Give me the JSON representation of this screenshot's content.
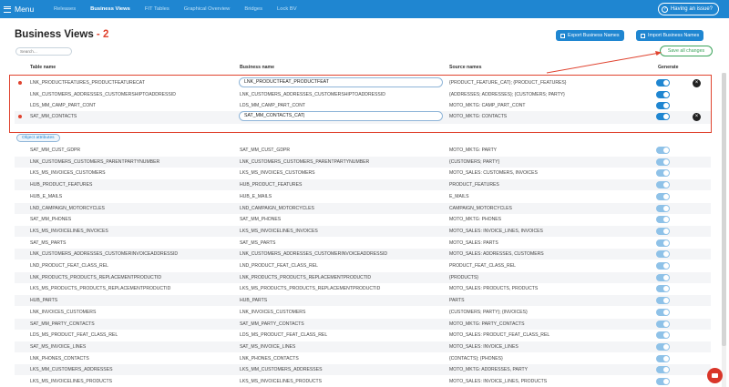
{
  "topbar": {
    "menu_label": "Menu",
    "nav": [
      "Releases",
      "Business Views",
      "FIT Tables",
      "Graphical Overview",
      "Bridges",
      "Lock BV"
    ],
    "active_nav": "Business Views",
    "issue_label": "Having an issue?"
  },
  "page": {
    "title": "Business Views",
    "title_sep": " - ",
    "count": "2",
    "export_label": "Export Business Names",
    "import_label": "Import Business Names",
    "save_label": "Save all changes",
    "search_placeholder": "Search...",
    "object_attributes_label": "Object attributes"
  },
  "table": {
    "headers": {
      "table_name": "Table name",
      "business_name": "Business name",
      "source_names": "Source names",
      "generate": "Generate"
    },
    "edited_rows": [
      {
        "table": "LNK_PRODUCTFEATURES_PRODUCTFEATURECAT",
        "business": "LNK_PRODUCTFEAT_PRODUCTFEAT",
        "source": "{PRODUCT_FEATURE_CAT}; {PRODUCT_FEATURES}",
        "edited": true,
        "editing": true
      },
      {
        "table": "LNK_CUSTOMERS_ADDRESSES_CUSTOMERSHIPTOADDRESSID",
        "business": "LNK_CUSTOMERS_ADDRESSES_CUSTOMERSHIPTOADDRESSID",
        "source": "{ADDRESSES; ADDRESSES}; {CUSTOMERS; PARTY}",
        "edited": false,
        "editing": false
      },
      {
        "table": "LDS_MM_CAMP_PART_CONT",
        "business": "LDS_MM_CAMP_PART_CONT",
        "source": "MOTO_MKTG: CAMP_PART_CONT",
        "edited": false,
        "editing": false
      },
      {
        "table": "SAT_MM_CONTACTS",
        "business": "SAT_MM_CONTACTS_CAT|",
        "source": "MOTO_MKTG: CONTACTS",
        "edited": true,
        "editing": true
      }
    ],
    "rows": [
      {
        "table": "SAT_MM_CUST_GDPR",
        "business": "SAT_MM_CUST_GDPR",
        "source": "MOTO_MKTG: PARTY"
      },
      {
        "table": "LNK_CUSTOMERS_CUSTOMERS_PARENTPARTYNUMBER",
        "business": "LNK_CUSTOMERS_CUSTOMERS_PARENTPARTYNUMBER",
        "source": "{CUSTOMERS; PARTY}"
      },
      {
        "table": "LKS_MS_INVOICES_CUSTOMERS",
        "business": "LKS_MS_INVOICES_CUSTOMERS",
        "source": "MOTO_SALES: CUSTOMERS, INVOICES"
      },
      {
        "table": "HUB_PRODUCT_FEATURES",
        "business": "HUB_PRODUCT_FEATURES",
        "source": "PRODUCT_FEATURES"
      },
      {
        "table": "HUB_E_MAILS",
        "business": "HUB_E_MAILS",
        "source": "E_MAILS"
      },
      {
        "table": "LND_CAMPAIGN_MOTORCYCLES",
        "business": "LND_CAMPAIGN_MOTORCYCLES",
        "source": "CAMPAIGN_MOTORCYCLES"
      },
      {
        "table": "SAT_MM_PHONES",
        "business": "SAT_MM_PHONES",
        "source": "MOTO_MKTG: PHONES"
      },
      {
        "table": "LKS_MS_INVOICELINES_INVOICES",
        "business": "LKS_MS_INVOICELINES_INVOICES",
        "source": "MOTO_SALES: INVOICE_LINES, INVOICES"
      },
      {
        "table": "SAT_MS_PARTS",
        "business": "SAT_MS_PARTS",
        "source": "MOTO_SALES: PARTS"
      },
      {
        "table": "LNK_CUSTOMERS_ADDRESSES_CUSTOMERINVOICEADDRESSID",
        "business": "LNK_CUSTOMERS_ADDRESSES_CUSTOMERINVOICEADDRESSID",
        "source": "MOTO_SALES: ADDRESSES, CUSTOMERS"
      },
      {
        "table": "LND_PRODUCT_FEAT_CLASS_REL",
        "business": "LND_PRODUCT_FEAT_CLASS_REL",
        "source": "PRODUCT_FEAT_CLASS_REL"
      },
      {
        "table": "LNK_PRODUCTS_PRODUCTS_REPLACEMENTPRODUCTID",
        "business": "LNK_PRODUCTS_PRODUCTS_REPLACEMENTPRODUCTID",
        "source": "{PRODUCTS}"
      },
      {
        "table": "LKS_MS_PRODUCTS_PRODUCTS_REPLACEMENTPRODUCTID",
        "business": "LKS_MS_PRODUCTS_PRODUCTS_REPLACEMENTPRODUCTID",
        "source": "MOTO_SALES: PRODUCTS, PRODUCTS"
      },
      {
        "table": "HUB_PARTS",
        "business": "HUB_PARTS",
        "source": "PARTS"
      },
      {
        "table": "LNK_INVOICES_CUSTOMERS",
        "business": "LNK_INVOICES_CUSTOMERS",
        "source": "{CUSTOMERS; PARTY}; {INVOICES}"
      },
      {
        "table": "SAT_MM_PARTY_CONTACTS",
        "business": "SAT_MM_PARTY_CONTACTS",
        "source": "MOTO_MKTG: PARTY_CONTACTS"
      },
      {
        "table": "LDS_MS_PRODUCT_FEAT_CLASS_REL",
        "business": "LDS_MS_PRODUCT_FEAT_CLASS_REL",
        "source": "MOTO_SALES: PRODUCT_FEAT_CLASS_REL"
      },
      {
        "table": "SAT_MS_INVOICE_LINES",
        "business": "SAT_MS_INVOICE_LINES",
        "source": "MOTO_SALES: INVOICE_LINES"
      },
      {
        "table": "LNK_PHONES_CONTACTS",
        "business": "LNK_PHONES_CONTACTS",
        "source": "{CONTACTS}; {PHONES}"
      },
      {
        "table": "LKS_MM_CUSTOMERS_ADDRESSES",
        "business": "LKS_MM_CUSTOMERS_ADDRESSES",
        "source": "MOTO_MKTG: ADDRESSES, PARTY"
      },
      {
        "table": "LKS_MS_INVOICELINES_PRODUCTS",
        "business": "LKS_MS_INVOICELINES_PRODUCTS",
        "source": "MOTO_SALES: INVOICE_LINES, PRODUCTS"
      }
    ]
  },
  "icons": {
    "menu": "hamburger-icon",
    "issue": "help-icon",
    "export": "export-icon",
    "import": "import-icon",
    "close": "close-icon",
    "fab": "chat-icon"
  },
  "colors": {
    "brand": "#1f86d1",
    "accent_red": "#e0432f",
    "save_green": "#3aa35a"
  }
}
